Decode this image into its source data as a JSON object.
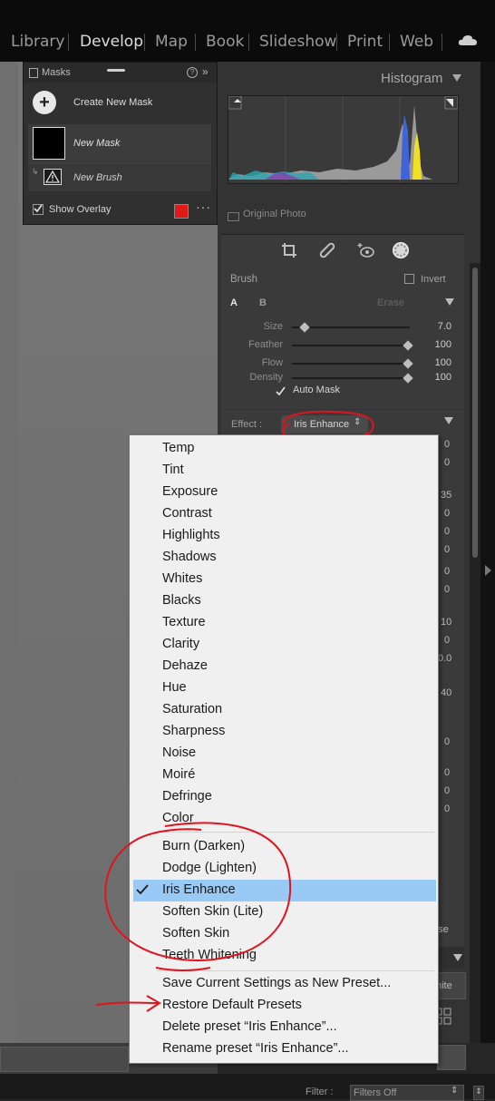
{
  "top_modules": [
    "Library",
    "Develop",
    "Map",
    "Book",
    "Slideshow",
    "Print",
    "Web"
  ],
  "top_active": "Develop",
  "masks": {
    "title": "Masks",
    "create_label": "Create New Mask",
    "new_mask": "New Mask",
    "new_brush": "New Brush",
    "show_overlay": "Show Overlay",
    "overlay_color": "#e0191b"
  },
  "histogram": {
    "title": "Histogram",
    "original_photo": "Original Photo"
  },
  "brush": {
    "title": "Brush",
    "invert": "Invert",
    "tab_a": "A",
    "tab_b": "B",
    "erase": "Erase",
    "auto_mask": "Auto Mask",
    "sliders": [
      {
        "label": "Size",
        "value": "7.0",
        "level": 0.08
      },
      {
        "label": "Feather",
        "value": "100",
        "level": 1.0
      },
      {
        "label": "Flow",
        "value": "100",
        "level": 1.0
      },
      {
        "label": "Density",
        "value": "100",
        "level": 1.0
      }
    ]
  },
  "effect": {
    "label": "Effect :",
    "selected": "Iris Enhance"
  },
  "right_values": [
    "0",
    "0",
    "35",
    "0",
    "0",
    "0",
    "0",
    "0",
    "10",
    "0",
    "0.0",
    "40",
    "0",
    "0",
    "0",
    "0"
  ],
  "right_fragments": {
    "close_text": "ose",
    "white_text": "hite"
  },
  "menu": {
    "params": [
      "Temp",
      "Tint",
      "Exposure",
      "Contrast",
      "Highlights",
      "Shadows",
      "Whites",
      "Blacks",
      "Texture",
      "Clarity",
      "Dehaze",
      "Hue",
      "Saturation",
      "Sharpness",
      "Noise",
      "Moiré",
      "Defringe",
      "Color"
    ],
    "presets": [
      "Burn (Darken)",
      "Dodge (Lighten)",
      "Iris Enhance",
      "Soften Skin (Lite)",
      "Soften Skin",
      "Teeth Whitening"
    ],
    "actions": [
      "Save Current Settings as New Preset...",
      "Restore Default Presets",
      "Delete preset “Iris Enhance”...",
      "Rename preset “Iris Enhance”..."
    ]
  },
  "filter": {
    "label": "Filter :",
    "value": "Filters Off"
  }
}
